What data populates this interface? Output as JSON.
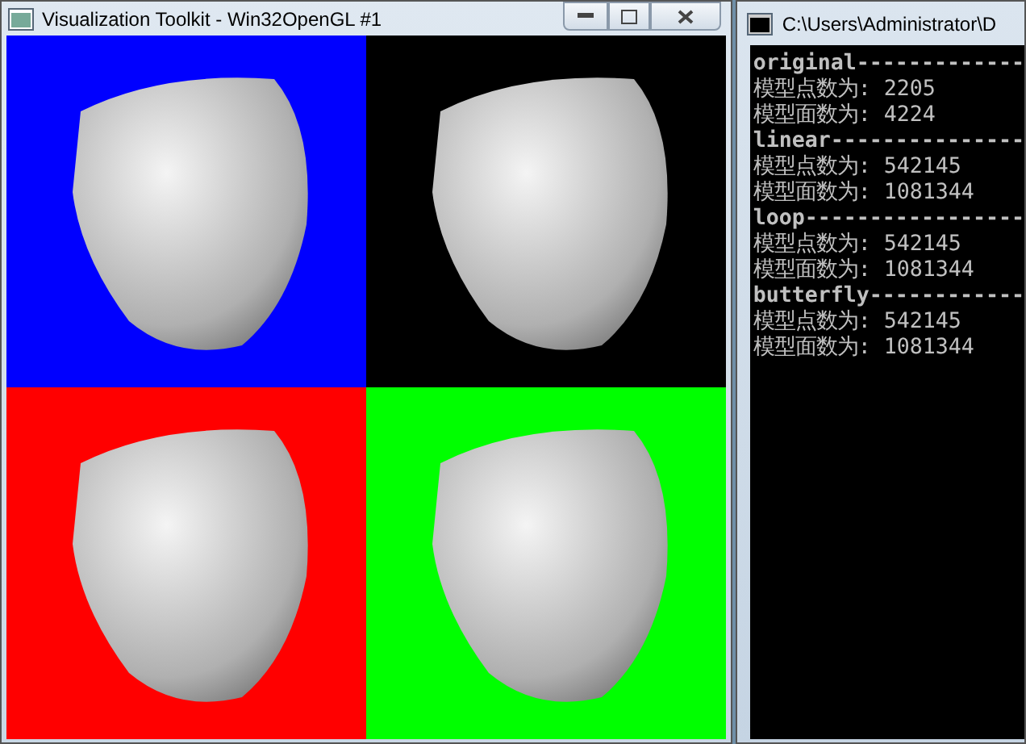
{
  "render_window": {
    "title": "Visualization Toolkit - Win32OpenGL #1",
    "viewports": [
      {
        "color": "#0000ff"
      },
      {
        "color": "#000000"
      },
      {
        "color": "#ff0000"
      },
      {
        "color": "#00ff00"
      }
    ]
  },
  "console_window": {
    "title": "C:\\Users\\Administrator\\D",
    "lines": [
      {
        "kind": "header",
        "text": "original-------------"
      },
      {
        "kind": "row",
        "text": "模型点数为:  2205"
      },
      {
        "kind": "row",
        "text": "模型面数为:  4224"
      },
      {
        "kind": "header",
        "text": "linear---------------"
      },
      {
        "kind": "row",
        "text": "模型点数为:  542145"
      },
      {
        "kind": "row",
        "text": "模型面数为:  1081344"
      },
      {
        "kind": "header",
        "text": "loop-----------------"
      },
      {
        "kind": "row",
        "text": "模型点数为:  542145"
      },
      {
        "kind": "row",
        "text": "模型面数为:  1081344"
      },
      {
        "kind": "header",
        "text": "butterfly------------"
      },
      {
        "kind": "row",
        "text": "模型点数为:  542145"
      },
      {
        "kind": "row",
        "text": "模型面数为:  1081344"
      }
    ]
  }
}
